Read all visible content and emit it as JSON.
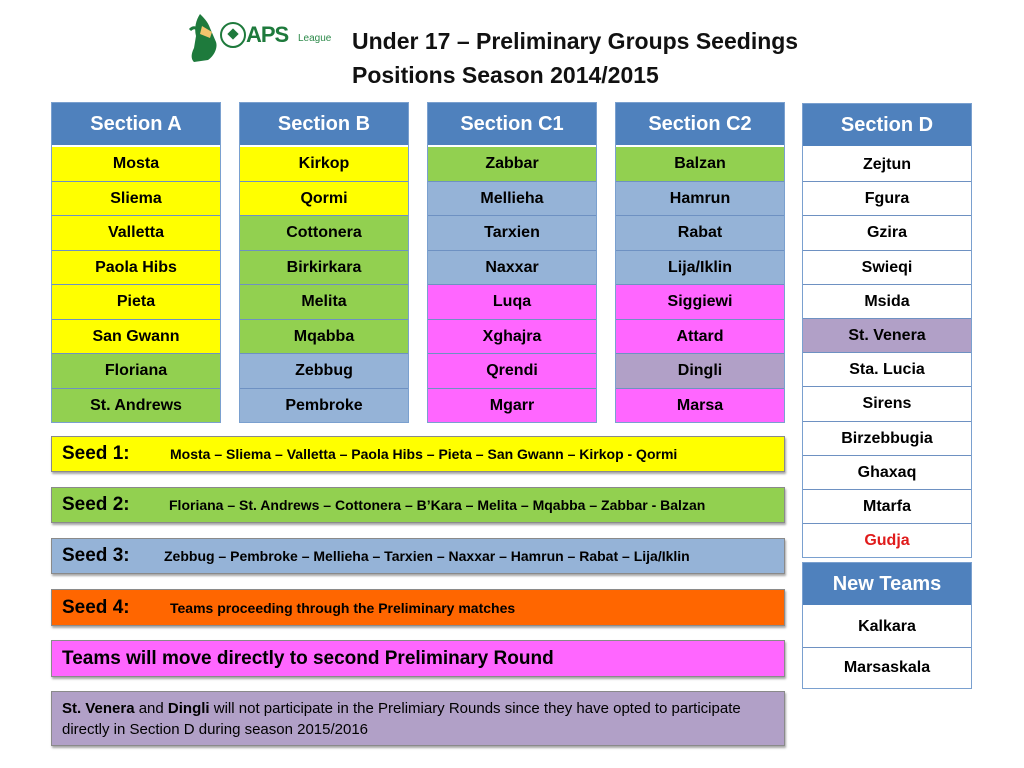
{
  "logo": {
    "brand": "APS",
    "sub": "League"
  },
  "title": {
    "line1": "Under 17 – Preliminary Groups Seedings",
    "line2": "Positions Season 2014/2015"
  },
  "colors": {
    "header_blue": "#4f81bd",
    "seed1_yellow": "#ffff00",
    "seed2_green": "#92d050",
    "seed3_blue": "#95b3d7",
    "seed4_orange": "#ff6600",
    "direct_magenta": "#ff66ff",
    "optout_purple": "#b1a0c7",
    "white": "#ffffff",
    "highlight_red": "#e01b1b"
  },
  "sections": [
    {
      "id": "sec-a",
      "title": "Section A",
      "teams": [
        {
          "name": "Mosta",
          "color": "#ffff00"
        },
        {
          "name": "Sliema",
          "color": "#ffff00"
        },
        {
          "name": "Valletta",
          "color": "#ffff00"
        },
        {
          "name": "Paola Hibs",
          "color": "#ffff00"
        },
        {
          "name": "Pieta",
          "color": "#ffff00"
        },
        {
          "name": "San Gwann",
          "color": "#ffff00"
        },
        {
          "name": "Floriana",
          "color": "#92d050"
        },
        {
          "name": "St. Andrews",
          "color": "#92d050"
        }
      ]
    },
    {
      "id": "sec-b",
      "title": "Section B",
      "teams": [
        {
          "name": "Kirkop",
          "color": "#ffff00"
        },
        {
          "name": "Qormi",
          "color": "#ffff00"
        },
        {
          "name": "Cottonera",
          "color": "#92d050"
        },
        {
          "name": "Birkirkara",
          "color": "#92d050"
        },
        {
          "name": "Melita",
          "color": "#92d050"
        },
        {
          "name": "Mqabba",
          "color": "#92d050"
        },
        {
          "name": "Zebbug",
          "color": "#95b3d7"
        },
        {
          "name": "Pembroke",
          "color": "#95b3d7"
        }
      ]
    },
    {
      "id": "sec-c1",
      "title": "Section C1",
      "teams": [
        {
          "name": "Zabbar",
          "color": "#92d050"
        },
        {
          "name": "Mellieha",
          "color": "#95b3d7"
        },
        {
          "name": "Tarxien",
          "color": "#95b3d7"
        },
        {
          "name": "Naxxar",
          "color": "#95b3d7"
        },
        {
          "name": "Luqa",
          "color": "#ff66ff"
        },
        {
          "name": "Xghajra",
          "color": "#ff66ff"
        },
        {
          "name": "Qrendi",
          "color": "#ff66ff"
        },
        {
          "name": "Mgarr",
          "color": "#ff66ff"
        }
      ]
    },
    {
      "id": "sec-c2",
      "title": "Section C2",
      "teams": [
        {
          "name": "Balzan",
          "color": "#92d050"
        },
        {
          "name": "Hamrun",
          "color": "#95b3d7"
        },
        {
          "name": "Rabat",
          "color": "#95b3d7"
        },
        {
          "name": "Lija/Iklin",
          "color": "#95b3d7"
        },
        {
          "name": "Siggiewi",
          "color": "#ff66ff"
        },
        {
          "name": "Attard",
          "color": "#ff66ff"
        },
        {
          "name": "Dingli",
          "color": "#b1a0c7"
        },
        {
          "name": "Marsa",
          "color": "#ff66ff"
        }
      ]
    },
    {
      "id": "sec-d",
      "title": "Section D",
      "teams": [
        {
          "name": "Zejtun",
          "color": "#ffffff"
        },
        {
          "name": "Fgura",
          "color": "#ffffff"
        },
        {
          "name": "Gzira",
          "color": "#ffffff"
        },
        {
          "name": "Swieqi",
          "color": "#ffffff"
        },
        {
          "name": "Msida",
          "color": "#ffffff"
        },
        {
          "name": "St. Venera",
          "color": "#b1a0c7"
        },
        {
          "name": "Sta. Lucia",
          "color": "#ffffff"
        },
        {
          "name": "Sirens",
          "color": "#ffffff"
        },
        {
          "name": "Birzebbugia",
          "color": "#ffffff"
        },
        {
          "name": "Ghaxaq",
          "color": "#ffffff"
        },
        {
          "name": "Mtarfa",
          "color": "#ffffff"
        },
        {
          "name": "Gudja",
          "color": "#ffffff",
          "text_color": "#e01b1b"
        }
      ]
    },
    {
      "id": "sec-new",
      "title": "New Teams",
      "teams": [
        {
          "name": "Kalkara",
          "color": "#ffffff"
        },
        {
          "name": "Marsaskala",
          "color": "#ffffff"
        }
      ]
    }
  ],
  "seeds": [
    {
      "label": "Seed 1:",
      "text": "Mosta – Sliema – Valletta – Paola Hibs – Pieta – San Gwann – Kirkop - Qormi",
      "color": "#ffff00"
    },
    {
      "label": "Seed 2:",
      "text": "Floriana – St. Andrews – Cottonera – B’Kara – Melita – Mqabba – Zabbar - Balzan",
      "color": "#92d050"
    },
    {
      "label": "Seed 3:",
      "text": "Zebbug – Pembroke – Mellieha – Tarxien – Naxxar – Hamrun – Rabat – Lija/Iklin",
      "color": "#95b3d7"
    },
    {
      "label": "Seed 4:",
      "text": "Teams proceeding through the  Preliminary  matches",
      "color": "#ff6600"
    }
  ],
  "direct": {
    "text": "Teams will move directly to second Preliminary Round",
    "color": "#ff66ff"
  },
  "note": {
    "team1": "St. Venera",
    "and": " and ",
    "team2": "Dingli",
    "rest": " will not participate in the Prelimiary Rounds since they have opted to participate directly in Section D during season 2015/2016",
    "color": "#b1a0c7"
  }
}
